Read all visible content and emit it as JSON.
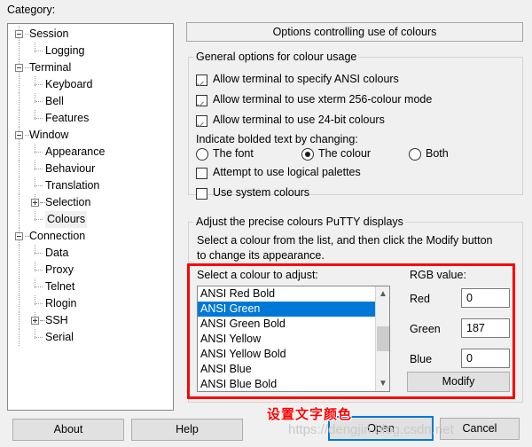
{
  "dialog": {
    "category_label": "Category:",
    "panel_title": "Options controlling use of colours"
  },
  "tree": {
    "items": [
      {
        "label": "Session",
        "level": 0,
        "expander": "minus"
      },
      {
        "label": "Logging",
        "level": 1,
        "expander": "none"
      },
      {
        "label": "Terminal",
        "level": 0,
        "expander": "minus"
      },
      {
        "label": "Keyboard",
        "level": 1,
        "expander": "none"
      },
      {
        "label": "Bell",
        "level": 1,
        "expander": "none"
      },
      {
        "label": "Features",
        "level": 1,
        "expander": "none"
      },
      {
        "label": "Window",
        "level": 0,
        "expander": "minus"
      },
      {
        "label": "Appearance",
        "level": 1,
        "expander": "none"
      },
      {
        "label": "Behaviour",
        "level": 1,
        "expander": "none"
      },
      {
        "label": "Translation",
        "level": 1,
        "expander": "none"
      },
      {
        "label": "Selection",
        "level": 1,
        "expander": "plus"
      },
      {
        "label": "Colours",
        "level": 1,
        "expander": "none",
        "selected": true
      },
      {
        "label": "Connection",
        "level": 0,
        "expander": "minus"
      },
      {
        "label": "Data",
        "level": 1,
        "expander": "none"
      },
      {
        "label": "Proxy",
        "level": 1,
        "expander": "none"
      },
      {
        "label": "Telnet",
        "level": 1,
        "expander": "none"
      },
      {
        "label": "Rlogin",
        "level": 1,
        "expander": "none"
      },
      {
        "label": "SSH",
        "level": 1,
        "expander": "plus"
      },
      {
        "label": "Serial",
        "level": 1,
        "expander": "none"
      }
    ]
  },
  "general_group": {
    "title": "General options for colour usage",
    "checkboxes": [
      {
        "label": "Allow terminal to specify ANSI colours",
        "checked": true
      },
      {
        "label": "Allow terminal to use xterm 256-colour mode",
        "checked": true
      },
      {
        "label": "Allow terminal to use 24-bit colours",
        "checked": true
      }
    ],
    "bold_label": "Indicate bolded text by changing:",
    "radios": [
      {
        "label": "The font",
        "checked": false
      },
      {
        "label": "The colour",
        "checked": true
      },
      {
        "label": "Both",
        "checked": false
      }
    ],
    "extra_checkboxes": [
      {
        "label": "Attempt to use logical palettes",
        "checked": false
      },
      {
        "label": "Use system colours",
        "checked": false
      }
    ]
  },
  "precise_group": {
    "title": "Adjust the precise colours PuTTY displays",
    "description_line1": "Select a colour from the list, and then click the Modify button",
    "description_line2": "to change its appearance.",
    "list_label": "Select a colour to adjust:",
    "rgb_label": "RGB value:",
    "colour_list": [
      {
        "label": "ANSI Red Bold",
        "selected": false
      },
      {
        "label": "ANSI Green",
        "selected": true
      },
      {
        "label": "ANSI Green Bold",
        "selected": false
      },
      {
        "label": "ANSI Yellow",
        "selected": false
      },
      {
        "label": "ANSI Yellow Bold",
        "selected": false
      },
      {
        "label": "ANSI Blue",
        "selected": false
      },
      {
        "label": "ANSI Blue Bold",
        "selected": false
      }
    ],
    "rgb_fields": [
      {
        "label": "Red",
        "value": "0"
      },
      {
        "label": "Green",
        "value": "187"
      },
      {
        "label": "Blue",
        "value": "0"
      }
    ],
    "modify_label": "Modify",
    "selection_color": "#0078d7"
  },
  "footer": {
    "about_label": "About",
    "help_label": "Help",
    "open_label": "Open",
    "cancel_label": "Cancel"
  },
  "overlay": {
    "annotation_text": "设置文字颜色",
    "annotation_color": "#ff0000",
    "watermark_text": "https://dengjin.blog.csdn.net",
    "highlight_box_color": "#ff0000"
  }
}
